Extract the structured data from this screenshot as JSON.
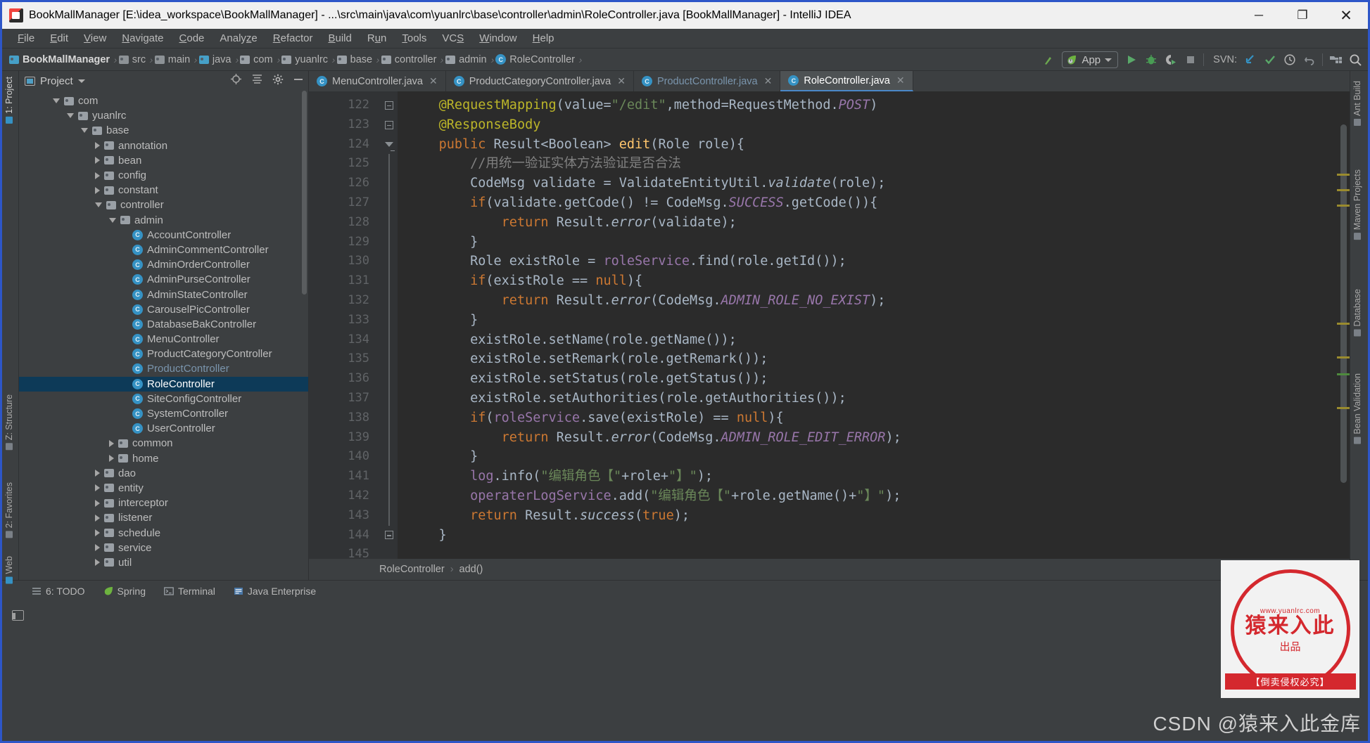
{
  "window": {
    "title": "BookMallManager [E:\\idea_workspace\\BookMallManager] - ...\\src\\main\\java\\com\\yuanlrc\\base\\controller\\admin\\RoleController.java [BookMallManager] - IntelliJ IDEA",
    "minimize": "─",
    "maximize": "❐",
    "close": "✕"
  },
  "menubar": [
    {
      "label": "File",
      "mnemonic": "F"
    },
    {
      "label": "Edit",
      "mnemonic": "E"
    },
    {
      "label": "View",
      "mnemonic": "V"
    },
    {
      "label": "Navigate",
      "mnemonic": "N"
    },
    {
      "label": "Code",
      "mnemonic": "C"
    },
    {
      "label": "Analyze",
      "mnemonic": "z"
    },
    {
      "label": "Refactor",
      "mnemonic": "R"
    },
    {
      "label": "Build",
      "mnemonic": "B"
    },
    {
      "label": "Run",
      "mnemonic": "u"
    },
    {
      "label": "Tools",
      "mnemonic": "T"
    },
    {
      "label": "VCS",
      "mnemonic": "S"
    },
    {
      "label": "Window",
      "mnemonic": "W"
    },
    {
      "label": "Help",
      "mnemonic": "H"
    }
  ],
  "breadcrumb": [
    {
      "label": "BookMallManager",
      "icon": "module-folder-icon",
      "bold": true,
      "type": "folder-blue"
    },
    {
      "label": "src",
      "icon": "folder-icon",
      "bold": false,
      "type": "folder-plain"
    },
    {
      "label": "main",
      "icon": "folder-icon",
      "bold": false,
      "type": "folder-plain"
    },
    {
      "label": "java",
      "icon": "source-folder-icon",
      "bold": false,
      "type": "folder-blue"
    },
    {
      "label": "com",
      "icon": "package-icon",
      "bold": false,
      "type": "folder"
    },
    {
      "label": "yuanlrc",
      "icon": "package-icon",
      "bold": false,
      "type": "folder"
    },
    {
      "label": "base",
      "icon": "package-icon",
      "bold": false,
      "type": "folder"
    },
    {
      "label": "controller",
      "icon": "package-icon",
      "bold": false,
      "type": "folder"
    },
    {
      "label": "admin",
      "icon": "package-icon",
      "bold": false,
      "type": "folder"
    },
    {
      "label": "RoleController",
      "icon": "java-class-icon",
      "bold": false,
      "type": "class"
    }
  ],
  "toolbar": {
    "run_config": "App",
    "svn_label": "SVN:",
    "icons": [
      "build-icon",
      "run-icon",
      "debug-icon",
      "run-coverage-icon",
      "stop-icon",
      "update-project-icon",
      "commit-icon",
      "history-icon",
      "rollback-icon",
      "project-structure-icon",
      "search-everywhere-icon"
    ]
  },
  "tool_windows": {
    "left": [
      {
        "label": "1: Project",
        "active": true
      },
      {
        "label": "Z: Structure",
        "active": false
      },
      {
        "label": "2: Favorites",
        "active": false
      },
      {
        "label": "Web",
        "active": false
      }
    ],
    "right": [
      {
        "label": "Ant Build"
      },
      {
        "label": "Maven Projects"
      },
      {
        "label": "Database"
      },
      {
        "label": "Bean Validation"
      }
    ]
  },
  "project_panel": {
    "title": "Project",
    "header_icons": [
      "locate-icon",
      "collapse-all-icon",
      "settings-icon",
      "hide-icon"
    ],
    "tree": [
      {
        "label": "com",
        "depth": 2,
        "state": "open",
        "icon": "package-icon"
      },
      {
        "label": "yuanlrc",
        "depth": 3,
        "state": "open",
        "icon": "package-icon"
      },
      {
        "label": "base",
        "depth": 4,
        "state": "open",
        "icon": "package-icon"
      },
      {
        "label": "annotation",
        "depth": 5,
        "state": "closed",
        "icon": "package-icon"
      },
      {
        "label": "bean",
        "depth": 5,
        "state": "closed",
        "icon": "package-icon"
      },
      {
        "label": "config",
        "depth": 5,
        "state": "closed",
        "icon": "package-icon"
      },
      {
        "label": "constant",
        "depth": 5,
        "state": "closed",
        "icon": "package-icon"
      },
      {
        "label": "controller",
        "depth": 5,
        "state": "open",
        "icon": "package-icon"
      },
      {
        "label": "admin",
        "depth": 6,
        "state": "open",
        "icon": "package-icon"
      },
      {
        "label": "AccountController",
        "depth": 7,
        "state": "leaf",
        "icon": "java-class-icon"
      },
      {
        "label": "AdminCommentController",
        "depth": 7,
        "state": "leaf",
        "icon": "java-class-icon"
      },
      {
        "label": "AdminOrderController",
        "depth": 7,
        "state": "leaf",
        "icon": "java-class-icon"
      },
      {
        "label": "AdminPurseController",
        "depth": 7,
        "state": "leaf",
        "icon": "java-class-icon"
      },
      {
        "label": "AdminStateController",
        "depth": 7,
        "state": "leaf",
        "icon": "java-class-icon"
      },
      {
        "label": "CarouselPicController",
        "depth": 7,
        "state": "leaf",
        "icon": "java-class-icon"
      },
      {
        "label": "DatabaseBakController",
        "depth": 7,
        "state": "leaf",
        "icon": "java-class-icon"
      },
      {
        "label": "MenuController",
        "depth": 7,
        "state": "leaf",
        "icon": "java-class-icon"
      },
      {
        "label": "ProductCategoryController",
        "depth": 7,
        "state": "leaf",
        "icon": "java-class-icon"
      },
      {
        "label": "ProductController",
        "depth": 7,
        "state": "leaf",
        "icon": "java-class-icon",
        "muted": true
      },
      {
        "label": "RoleController",
        "depth": 7,
        "state": "leaf",
        "icon": "java-class-icon",
        "selected": true
      },
      {
        "label": "SiteConfigController",
        "depth": 7,
        "state": "leaf",
        "icon": "java-class-icon"
      },
      {
        "label": "SystemController",
        "depth": 7,
        "state": "leaf",
        "icon": "java-class-icon"
      },
      {
        "label": "UserController",
        "depth": 7,
        "state": "leaf",
        "icon": "java-class-icon"
      },
      {
        "label": "common",
        "depth": 6,
        "state": "closed",
        "icon": "package-icon"
      },
      {
        "label": "home",
        "depth": 6,
        "state": "closed",
        "icon": "package-icon"
      },
      {
        "label": "dao",
        "depth": 5,
        "state": "closed",
        "icon": "package-icon"
      },
      {
        "label": "entity",
        "depth": 5,
        "state": "closed",
        "icon": "package-icon"
      },
      {
        "label": "interceptor",
        "depth": 5,
        "state": "closed",
        "icon": "package-icon"
      },
      {
        "label": "listener",
        "depth": 5,
        "state": "closed",
        "icon": "package-icon"
      },
      {
        "label": "schedule",
        "depth": 5,
        "state": "closed",
        "icon": "package-icon"
      },
      {
        "label": "service",
        "depth": 5,
        "state": "closed",
        "icon": "package-icon"
      },
      {
        "label": "util",
        "depth": 5,
        "state": "closed",
        "icon": "package-icon"
      }
    ]
  },
  "editor": {
    "tabs": [
      {
        "label": "MenuController.java",
        "active": false,
        "muted": false,
        "closable": true
      },
      {
        "label": "ProductCategoryController.java",
        "active": false,
        "muted": false,
        "closable": true
      },
      {
        "label": "ProductController.java",
        "active": false,
        "muted": true,
        "closable": true
      },
      {
        "label": "RoleController.java",
        "active": true,
        "muted": false,
        "closable": true
      }
    ],
    "first_line": 122,
    "lines": [
      {
        "n": 122,
        "fold": "minus",
        "tokens": [
          {
            "t": "    ",
            "c": ""
          },
          {
            "t": "@RequestMapping",
            "c": "ann"
          },
          {
            "t": "(",
            "c": ""
          },
          {
            "t": "value",
            "c": ""
          },
          {
            "t": "=",
            "c": ""
          },
          {
            "t": "\"/edit\"",
            "c": "str"
          },
          {
            "t": ",",
            "c": ""
          },
          {
            "t": "method",
            "c": ""
          },
          {
            "t": "=",
            "c": ""
          },
          {
            "t": "RequestMethod.",
            "c": ""
          },
          {
            "t": "POST",
            "c": "stat"
          },
          {
            "t": ")",
            "c": ""
          }
        ]
      },
      {
        "n": 123,
        "fold": "minus",
        "tokens": [
          {
            "t": "    ",
            "c": ""
          },
          {
            "t": "@ResponseBody",
            "c": "ann"
          }
        ]
      },
      {
        "n": 124,
        "fold": "triangle",
        "tokens": [
          {
            "t": "    ",
            "c": ""
          },
          {
            "t": "public ",
            "c": "kw"
          },
          {
            "t": "Result<Boolean> ",
            "c": ""
          },
          {
            "t": "edit",
            "c": "mth"
          },
          {
            "t": "(Role role){",
            "c": ""
          }
        ]
      },
      {
        "n": 125,
        "fold": "bar",
        "tokens": [
          {
            "t": "        ",
            "c": ""
          },
          {
            "t": "//用统一验证实体方法验证是否合法",
            "c": "com"
          }
        ]
      },
      {
        "n": 126,
        "fold": "bar",
        "tokens": [
          {
            "t": "        CodeMsg validate = ValidateEntityUtil.",
            "c": ""
          },
          {
            "t": "validate",
            "c": "itmth"
          },
          {
            "t": "(role);",
            "c": ""
          }
        ]
      },
      {
        "n": 127,
        "fold": "bar",
        "tokens": [
          {
            "t": "        ",
            "c": ""
          },
          {
            "t": "if",
            "c": "kw"
          },
          {
            "t": "(validate.getCode() != CodeMsg.",
            "c": ""
          },
          {
            "t": "SUCCESS",
            "c": "stat"
          },
          {
            "t": ".getCode()){",
            "c": ""
          }
        ]
      },
      {
        "n": 128,
        "fold": "bar",
        "tokens": [
          {
            "t": "            ",
            "c": ""
          },
          {
            "t": "return ",
            "c": "kw"
          },
          {
            "t": "Result.",
            "c": ""
          },
          {
            "t": "error",
            "c": "itmth"
          },
          {
            "t": "(validate);",
            "c": ""
          }
        ]
      },
      {
        "n": 129,
        "fold": "bar",
        "tokens": [
          {
            "t": "        }",
            "c": ""
          }
        ]
      },
      {
        "n": 130,
        "fold": "bar",
        "tokens": [
          {
            "t": "        Role existRole = ",
            "c": ""
          },
          {
            "t": "roleService",
            "c": "fld"
          },
          {
            "t": ".find(role.getId());",
            "c": ""
          }
        ]
      },
      {
        "n": 131,
        "fold": "bar",
        "tokens": [
          {
            "t": "        ",
            "c": ""
          },
          {
            "t": "if",
            "c": "kw"
          },
          {
            "t": "(existRole == ",
            "c": ""
          },
          {
            "t": "null",
            "c": "kw"
          },
          {
            "t": "){",
            "c": ""
          }
        ]
      },
      {
        "n": 132,
        "fold": "bar",
        "tokens": [
          {
            "t": "            ",
            "c": ""
          },
          {
            "t": "return ",
            "c": "kw"
          },
          {
            "t": "Result.",
            "c": ""
          },
          {
            "t": "error",
            "c": "itmth"
          },
          {
            "t": "(CodeMsg.",
            "c": ""
          },
          {
            "t": "ADMIN_ROLE_NO_EXIST",
            "c": "stat"
          },
          {
            "t": ");",
            "c": ""
          }
        ]
      },
      {
        "n": 133,
        "fold": "bar",
        "tokens": [
          {
            "t": "        }",
            "c": ""
          }
        ]
      },
      {
        "n": 134,
        "fold": "bar",
        "tokens": [
          {
            "t": "        existRole.setName(role.getName());",
            "c": ""
          }
        ]
      },
      {
        "n": 135,
        "fold": "bar",
        "tokens": [
          {
            "t": "        existRole.setRemark(role.getRemark());",
            "c": ""
          }
        ]
      },
      {
        "n": 136,
        "fold": "bar",
        "tokens": [
          {
            "t": "        existRole.setStatus(role.getStatus());",
            "c": ""
          }
        ]
      },
      {
        "n": 137,
        "fold": "bar",
        "tokens": [
          {
            "t": "        existRole.setAuthorities(role.getAuthorities());",
            "c": ""
          }
        ]
      },
      {
        "n": 138,
        "fold": "bar",
        "tokens": [
          {
            "t": "        ",
            "c": ""
          },
          {
            "t": "if",
            "c": "kw"
          },
          {
            "t": "(",
            "c": ""
          },
          {
            "t": "roleService",
            "c": "fld"
          },
          {
            "t": ".save(existRole) == ",
            "c": ""
          },
          {
            "t": "null",
            "c": "kw"
          },
          {
            "t": "){",
            "c": ""
          }
        ]
      },
      {
        "n": 139,
        "fold": "bar",
        "tokens": [
          {
            "t": "            ",
            "c": ""
          },
          {
            "t": "return ",
            "c": "kw"
          },
          {
            "t": "Result.",
            "c": ""
          },
          {
            "t": "error",
            "c": "itmth"
          },
          {
            "t": "(CodeMsg.",
            "c": ""
          },
          {
            "t": "ADMIN_ROLE_EDIT_ERROR",
            "c": "stat"
          },
          {
            "t": ");",
            "c": ""
          }
        ]
      },
      {
        "n": 140,
        "fold": "bar",
        "tokens": [
          {
            "t": "        }",
            "c": ""
          }
        ]
      },
      {
        "n": 141,
        "fold": "bar",
        "tokens": [
          {
            "t": "        ",
            "c": ""
          },
          {
            "t": "log",
            "c": "fld"
          },
          {
            "t": ".info(",
            "c": ""
          },
          {
            "t": "\"编辑角色【\"",
            "c": "str"
          },
          {
            "t": "+role+",
            "c": ""
          },
          {
            "t": "\"】\"",
            "c": "str"
          },
          {
            "t": ");",
            "c": ""
          }
        ]
      },
      {
        "n": 142,
        "fold": "bar",
        "tokens": [
          {
            "t": "        ",
            "c": ""
          },
          {
            "t": "operaterLogService",
            "c": "fld"
          },
          {
            "t": ".add(",
            "c": ""
          },
          {
            "t": "\"编辑角色【\"",
            "c": "str"
          },
          {
            "t": "+role.getName()+",
            "c": ""
          },
          {
            "t": "\"】\"",
            "c": "str"
          },
          {
            "t": ");",
            "c": ""
          }
        ]
      },
      {
        "n": 143,
        "fold": "bar",
        "tokens": [
          {
            "t": "        ",
            "c": ""
          },
          {
            "t": "return ",
            "c": "kw"
          },
          {
            "t": "Result.",
            "c": ""
          },
          {
            "t": "success",
            "c": "itmth"
          },
          {
            "t": "(",
            "c": ""
          },
          {
            "t": "true",
            "c": "kw"
          },
          {
            "t": ");",
            "c": ""
          }
        ]
      },
      {
        "n": 144,
        "fold": "end",
        "tokens": [
          {
            "t": "    }",
            "c": ""
          }
        ]
      },
      {
        "n": 145,
        "fold": "none",
        "tokens": [
          {
            "t": "",
            "c": ""
          }
        ]
      }
    ],
    "bottom_breadcrumb": [
      {
        "label": "RoleController"
      },
      {
        "label": "add()"
      }
    ]
  },
  "statusbar": [
    {
      "label": "6: TODO",
      "icon": "todo-icon"
    },
    {
      "label": "Spring",
      "icon": "spring-leaf-icon"
    },
    {
      "label": "Terminal",
      "icon": "terminal-icon"
    },
    {
      "label": "Java Enterprise",
      "icon": "java-ee-icon"
    }
  ],
  "watermark": {
    "seal_url": "www.yuanlrc.com",
    "seal_main": "猿来入此",
    "seal_sub": "出品",
    "seal_bar": "【倒卖侵权必究】",
    "csdn": "CSDN @猿来入此金库"
  },
  "colors": {
    "accent_blue": "#3592c4",
    "selection": "#0d3a58",
    "editor_bg": "#2b2b2b",
    "panel_bg": "#3c3f41",
    "seal_red": "#d4282e"
  }
}
